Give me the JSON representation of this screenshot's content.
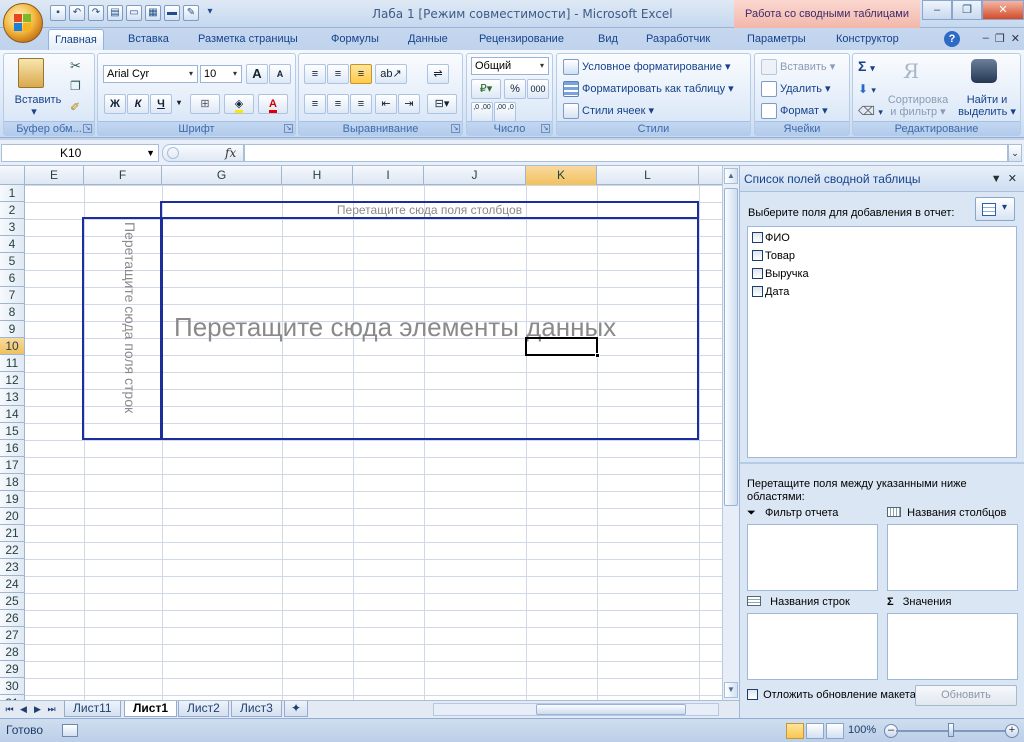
{
  "window": {
    "title": "Лаба 1  [Режим совместимости] - Microsoft Excel",
    "context_title": "Работа со сводными таблицами"
  },
  "tabs": [
    {
      "label": "Главная",
      "active": true
    },
    {
      "label": "Вставка"
    },
    {
      "label": "Разметка страницы"
    },
    {
      "label": "Формулы"
    },
    {
      "label": "Данные"
    },
    {
      "label": "Рецензирование"
    },
    {
      "label": "Вид"
    },
    {
      "label": "Разработчик"
    },
    {
      "label": "Параметры"
    },
    {
      "label": "Конструктор"
    }
  ],
  "ribbon": {
    "clipboard": {
      "paste": "Вставить",
      "label": "Буфер обм..."
    },
    "font": {
      "name": "Arial Cyr",
      "size": "10",
      "bold": "Ж",
      "italic": "К",
      "underline": "Ч",
      "grow": "A",
      "shrink": "A",
      "font_color_letter": "A",
      "label": "Шрифт"
    },
    "align": {
      "label": "Выравнивание"
    },
    "number": {
      "format": "Общий",
      "percent": "%",
      "thousands": "000",
      "inc": ",0 ,00",
      "dec": ",00 ,0",
      "label": "Число"
    },
    "styles": {
      "cond": "Условное форматирование",
      "table": "Форматировать как таблицу",
      "cell": "Стили ячеек",
      "label": "Стили"
    },
    "cells": {
      "insert": "Вставить",
      "delete": "Удалить",
      "format": "Формат",
      "label": "Ячейки"
    },
    "editing": {
      "sigma": "Σ",
      "sort_line1": "Сортировка",
      "sort_line2": "и фильтр",
      "find_line1": "Найти и",
      "find_line2": "выделить",
      "label": "Редактирование"
    }
  },
  "formula_bar": {
    "name_box": "K10",
    "fx": "fx",
    "value": ""
  },
  "grid": {
    "columns": [
      "E",
      "F",
      "G",
      "H",
      "I",
      "J",
      "K",
      "L"
    ],
    "selected_column": "K",
    "rows": [
      "1",
      "2",
      "3",
      "4",
      "5",
      "6",
      "7",
      "8",
      "9",
      "10",
      "11",
      "12",
      "13",
      "14",
      "15",
      "16",
      "17",
      "18",
      "19",
      "20",
      "21",
      "22",
      "23",
      "24",
      "25",
      "26",
      "27",
      "28",
      "29",
      "30",
      "31"
    ],
    "selected_row": "10",
    "pivot_columns_hint": "Перетащите сюда поля столбцов",
    "pivot_data_hint": "Перетащите сюда элементы данных",
    "pivot_rows_hint": "Перетащите сюда поля строк"
  },
  "sheets": [
    {
      "name": "Лист11"
    },
    {
      "name": "Лист1",
      "active": true
    },
    {
      "name": "Лист2"
    },
    {
      "name": "Лист3"
    }
  ],
  "status": {
    "ready": "Готово",
    "zoom": "100%"
  },
  "pane": {
    "title": "Список полей сводной таблицы",
    "choose_fields": "Выберите поля для добавления в отчет:",
    "fields": [
      "ФИО",
      "Товар",
      "Выручка",
      "Дата"
    ],
    "drag_hint": "Перетащите поля между указанными ниже областями:",
    "areas": {
      "filter": "Фильтр отчета",
      "columns": "Названия столбцов",
      "rows": "Названия строк",
      "values": "Значения"
    },
    "defer": "Отложить обновление макета",
    "update": "Обновить"
  }
}
